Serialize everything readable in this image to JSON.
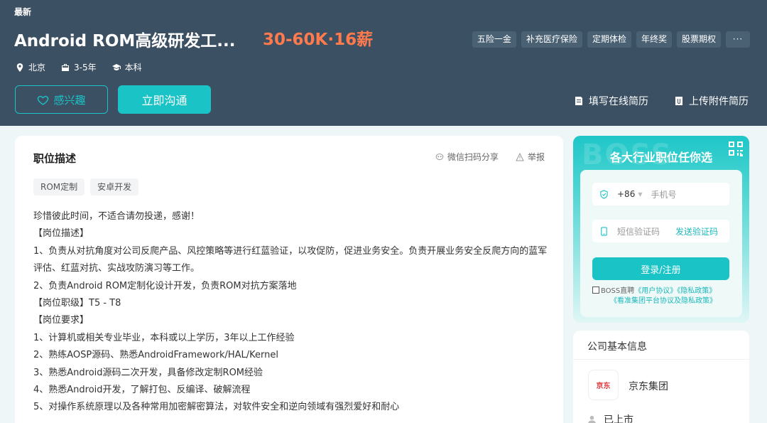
{
  "header": {
    "latest": "最新",
    "job_title": "Android ROM高级研发工...",
    "salary": "30-60K·16薪",
    "meta": {
      "city": "北京",
      "experience": "3-5年",
      "degree": "本科"
    },
    "welfare": [
      "五险一金",
      "补充医疗保险",
      "定期体检",
      "年终奖",
      "股票期权"
    ],
    "more": "···",
    "interest_label": "感兴趣",
    "chat_label": "立即沟通",
    "fill_resume": "填写在线简历",
    "upload_resume": "上传附件简历"
  },
  "job": {
    "section_title": "职位描述",
    "share": "微信扫码分享",
    "report": "举报",
    "skills": [
      "ROM定制",
      "安卓开发"
    ],
    "description": [
      "珍惜彼此时间，不适合请勿投递，感谢！",
      "【岗位描述】",
      "1、负责从对抗角度对公司反爬产品、风控策略等进行红蓝验证，以攻促防，促进业务安全。负责开展业务安全反爬方向的蓝军评估、红蓝对抗、实战攻防演习等工作。",
      "2、负责Android ROM定制化设计开发，负责ROM对抗方案落地",
      "【岗位职级】T5 - T8",
      "【岗位要求】",
      "1、计算机或相关专业毕业，本科或以上学历，3年以上工作经验",
      "2、熟练AOSP源码、熟悉AndroidFramework/HAL/Kernel",
      "3、熟悉Android源码二次开发，具备修改定制ROM经验",
      "4、熟悉Android开发，了解打包、反编译、破解流程",
      "5、对操作系统原理以及各种常用加密解密算法，对软件安全和逆向领域有强烈爱好和耐心"
    ]
  },
  "login": {
    "watermark": "BOSS",
    "title": "各大行业职位任你选",
    "country_code": "+86",
    "phone_placeholder": "手机号",
    "code_placeholder": "短信验证码",
    "send_code": "发送验证码",
    "submit": "登录/注册",
    "agree_prefix": "BOSS直聘",
    "user_agreement": "《用户协议》",
    "privacy_policy": "《隐私政策》",
    "group_agreement": "《看准集团平台协议及隐私政策》"
  },
  "company": {
    "section_title": "公司基本信息",
    "logo_text": "京东",
    "name": "京东集团",
    "status": "已上市"
  },
  "colors": {
    "header_bg": "#3c5063",
    "accent": "#19c3c6",
    "salary": "#ff7a4d"
  }
}
